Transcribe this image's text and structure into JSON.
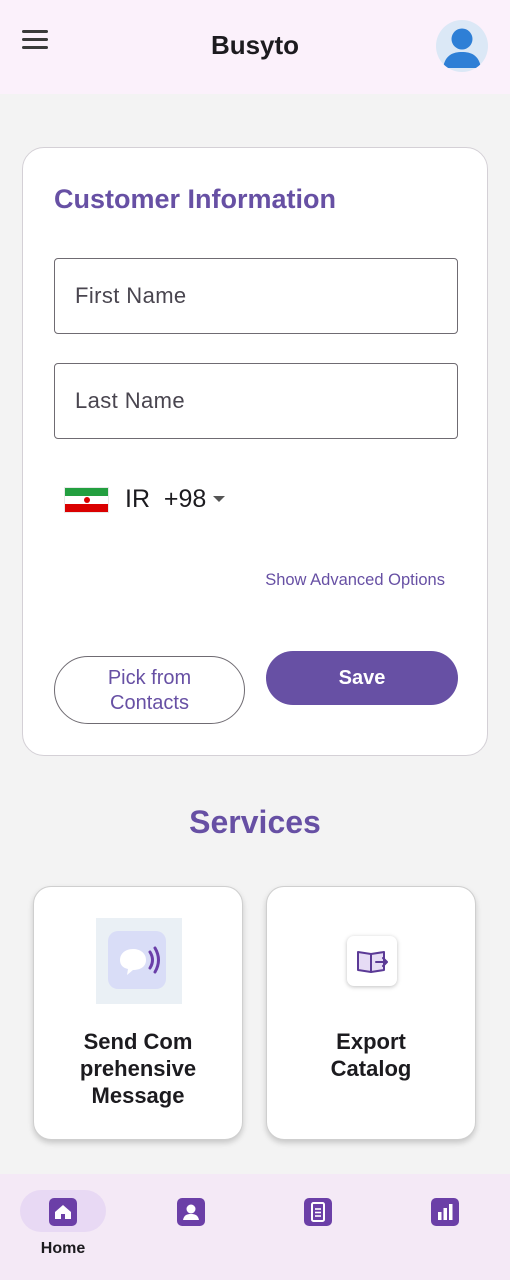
{
  "app": {
    "title": "Busyto"
  },
  "form": {
    "title": "Customer Information",
    "first_name_placeholder": "First Name",
    "last_name_placeholder": "Last Name",
    "country_code": "IR  +98",
    "advanced_link": "Show Advanced Options",
    "pick_contacts_line1": "Pick from",
    "pick_contacts_line2": "Contacts",
    "save_label": "Save"
  },
  "services": {
    "heading": "Services",
    "items": [
      {
        "label_lines": [
          "Send Com",
          "prehensive",
          "Message"
        ],
        "icon": "speech-bubble-waves-icon"
      },
      {
        "label_lines": [
          "Export",
          "Catalog"
        ],
        "icon": "book-export-icon"
      }
    ]
  },
  "nav": {
    "items": [
      {
        "label": "Home",
        "icon": "home-icon",
        "active": true
      },
      {
        "label": "",
        "icon": "person-icon",
        "active": false
      },
      {
        "label": "",
        "icon": "document-icon",
        "active": false
      },
      {
        "label": "",
        "icon": "bar-chart-icon",
        "active": false
      }
    ]
  },
  "colors": {
    "primary": "#6750a4",
    "appbar": "#fbf1fb",
    "nav_bg": "#f4e9f6"
  }
}
